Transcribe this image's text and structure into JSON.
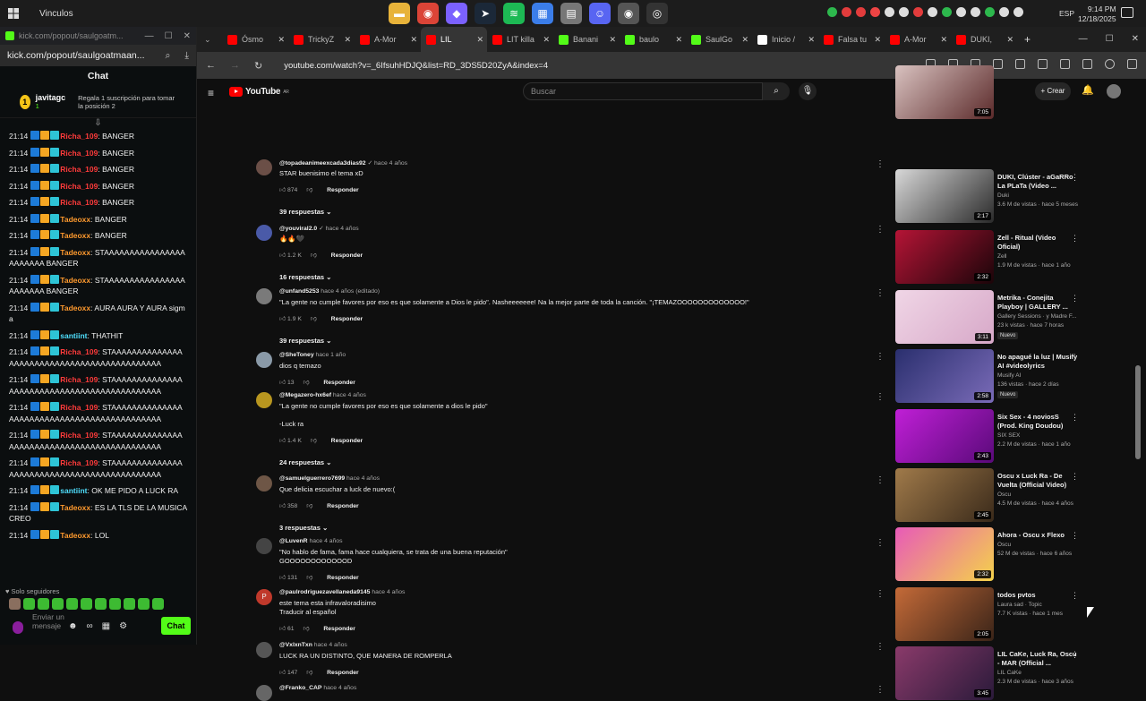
{
  "taskbar": {
    "title": "Vinculos",
    "lang": "ESP",
    "time": "9:14 PM",
    "date": "12/18/2025",
    "apps": [
      {
        "name": "file-explorer-icon",
        "color": "#e8b33a",
        "glyph": "▬"
      },
      {
        "name": "chrome-icon",
        "color": "#db4437",
        "glyph": "◉"
      },
      {
        "name": "copilot-icon",
        "color": "#7b61ff",
        "glyph": "◆"
      },
      {
        "name": "steam-icon",
        "color": "#1b2838",
        "glyph": "➤"
      },
      {
        "name": "spotify-icon",
        "color": "#1db954",
        "glyph": "≋"
      },
      {
        "name": "store-icon",
        "color": "#3b7de9",
        "glyph": "▦"
      },
      {
        "name": "folder-icon",
        "color": "#777",
        "glyph": "▤"
      },
      {
        "name": "discord-icon",
        "color": "#5865f2",
        "glyph": "☺"
      },
      {
        "name": "chrome-active-icon",
        "color": "#555",
        "glyph": "◉"
      },
      {
        "name": "obs-icon",
        "color": "#333",
        "glyph": "◎"
      }
    ],
    "tray_colors": [
      "#2db84d",
      "#e23c3c",
      "#e23c3c",
      "#ee4444",
      "#ddd",
      "#ddd",
      "#e23c3c",
      "#ddd",
      "#2db84d",
      "#ddd",
      "#ddd",
      "#2db84d",
      "#ddd",
      "#ddd"
    ]
  },
  "kick": {
    "window_title": "kick.com/popout/saulgoatm...",
    "url": "kick.com/popout/saulgoatmaan...",
    "header": "Chat",
    "pinned": {
      "badge": "1",
      "user": "javitagc",
      "count": "1",
      "text": "Regala 1 suscripción para tomar la posición 2"
    },
    "messages": [
      {
        "time": "21:14",
        "user": "Richa_109",
        "color": "#ff3b3b",
        "text": "BANGER"
      },
      {
        "time": "21:14",
        "user": "Richa_109",
        "color": "#ff3b3b",
        "text": "BANGER"
      },
      {
        "time": "21:14",
        "user": "Richa_109",
        "color": "#ff3b3b",
        "text": "BANGER"
      },
      {
        "time": "21:14",
        "user": "Richa_109",
        "color": "#ff3b3b",
        "text": "BANGER"
      },
      {
        "time": "21:14",
        "user": "Richa_109",
        "color": "#ff3b3b",
        "text": "BANGER"
      },
      {
        "time": "21:14",
        "user": "Tadeoxx",
        "color": "#ff9a2e",
        "text": "BANGER"
      },
      {
        "time": "21:14",
        "user": "Tadeoxx",
        "color": "#ff9a2e",
        "text": "BANGER"
      },
      {
        "time": "21:14",
        "user": "Tadeoxx",
        "color": "#ff9a2e",
        "text": "STAAAAAAAAAAAAAAAAAAAAAAA BANGER"
      },
      {
        "time": "21:14",
        "user": "Tadeoxx",
        "color": "#ff9a2e",
        "text": "STAAAAAAAAAAAAAAAAAAAAAAA BANGER"
      },
      {
        "time": "21:14",
        "user": "Tadeoxx",
        "color": "#ff9a2e",
        "text": "AURA AURA Y AURA sigma"
      },
      {
        "time": "21:14",
        "user": "santiint",
        "color": "#4fe0ff",
        "text": "THATHIT"
      },
      {
        "time": "21:14",
        "user": "Richa_109",
        "color": "#ff3b3b",
        "text": "STAAAAAAAAAAAAAAAAAAAAAAAAAAAAAAAAAAAAAAAAAAAA"
      },
      {
        "time": "21:14",
        "user": "Richa_109",
        "color": "#ff3b3b",
        "text": "STAAAAAAAAAAAAAAAAAAAAAAAAAAAAAAAAAAAAAAAAAAAA"
      },
      {
        "time": "21:14",
        "user": "Richa_109",
        "color": "#ff3b3b",
        "text": "STAAAAAAAAAAAAAAAAAAAAAAAAAAAAAAAAAAAAAAAAAAAA"
      },
      {
        "time": "21:14",
        "user": "Richa_109",
        "color": "#ff3b3b",
        "text": "STAAAAAAAAAAAAAAAAAAAAAAAAAAAAAAAAAAAAAAAAAAAA"
      },
      {
        "time": "21:14",
        "user": "Richa_109",
        "color": "#ff3b3b",
        "text": "STAAAAAAAAAAAAAAAAAAAAAAAAAAAAAAAAAAAAAAAAAAAA"
      },
      {
        "time": "21:14",
        "user": "santiint",
        "color": "#4fe0ff",
        "text": "OK ME PIDO A LUCK RA"
      },
      {
        "time": "21:14",
        "user": "Tadeoxx",
        "color": "#ff9a2e",
        "text": "ES LA TLS DE LA MUSICA CREO"
      },
      {
        "time": "21:14",
        "user": "Tadeoxx",
        "color": "#ff9a2e",
        "text": "LOL"
      }
    ],
    "solo": "Solo seguidores",
    "input_placeholder": "Enviar un mensaje",
    "chat_button": "Chat"
  },
  "chrome": {
    "tabs": [
      {
        "label": "Ósmo",
        "color": "#ff0000"
      },
      {
        "label": "TrickyZ",
        "color": "#ff0000"
      },
      {
        "label": "A-Mor",
        "color": "#ff0000"
      },
      {
        "label": "LIL",
        "color": "#ff0000",
        "active": true
      },
      {
        "label": "LIT killa",
        "color": "#ff0000"
      },
      {
        "label": "Banani",
        "color": "#53fc18"
      },
      {
        "label": "baulo",
        "color": "#53fc18"
      },
      {
        "label": "SaulGo",
        "color": "#53fc18"
      },
      {
        "label": "Inicio /",
        "color": "#fff"
      },
      {
        "label": "Falsa tu",
        "color": "#ff0000"
      },
      {
        "label": "A-Mor",
        "color": "#ff0000"
      },
      {
        "label": "DUKI,",
        "color": "#ff0000"
      }
    ],
    "url": "youtube.com/watch?v=_6IfsuhHDJQ&list=RD_3DS5D20ZyA&index=4"
  },
  "youtube": {
    "logo": "YouTube",
    "logo_sup": "AR",
    "search_placeholder": "Buscar",
    "create": "Crear",
    "comments": [
      {
        "user": "@topadeanimeexcada3dias92",
        "age": "✓ hace 4 años",
        "text": "STAR buenisimo el tema xD",
        "likes": "874",
        "replies": "39 respuestas",
        "avatar": "#6b4f47"
      },
      {
        "user": "@youviral2.0",
        "age": "✓ hace 4 años",
        "text": "🔥🔥🖤",
        "likes": "1.2 K",
        "replies": "16 respuestas",
        "avatar": "#4a5aa8"
      },
      {
        "user": "@unfand5253",
        "age": "hace 4 años (editado)",
        "text": "\"La gente no cumple favores por eso es que solamente a Dios le pido\". Nasheeeeeee! Na la mejor parte de toda la canción. \"¡TEMAZOOOOOOOOOOOOO!\"",
        "likes": "1.9 K",
        "replies": "39 respuestas",
        "avatar": "#7a7a7a"
      },
      {
        "user": "@SheToney",
        "age": "hace 1 año",
        "text": "dios q temazo",
        "likes": "13",
        "replies": "",
        "avatar": "#8a9aa8"
      },
      {
        "user": "@Megazero-hx6ef",
        "age": "hace 4 años",
        "text": "\"La gente no cumple favores por eso es que solamente a dios le pido\"\n\n-Luck ra",
        "likes": "1.4 K",
        "replies": "24 respuestas",
        "avatar": "#b8961f"
      },
      {
        "user": "@samuelguerrero7699",
        "age": "hace 4 años",
        "text": "Que delicia escuchar a luck de nuevo:(",
        "likes": "358",
        "replies": "3 respuestas",
        "avatar": "#6e5646"
      },
      {
        "user": "@LuvenR",
        "age": "hace 4 años",
        "text": "\"No hablo de fama, fama hace cualquiera, se trata de una buena reputación\"\nGOOOOOOOOOOOOD",
        "likes": "131",
        "replies": "",
        "avatar": "#444"
      },
      {
        "user": "@paulrodriguezavellaneda9145",
        "age": "hace 4 años",
        "text": "este tema esta infravaloradisimo\nTraducir al español",
        "likes": "61",
        "replies": "",
        "avatar": "#c0392b",
        "initial": "P"
      },
      {
        "user": "@VxlxnTxn",
        "age": "hace 4 años",
        "text": "LUCK RA UN DISTINTO, QUE MANERA DE ROMPERLA",
        "likes": "147",
        "replies": "",
        "avatar": "#555"
      },
      {
        "user": "@Franko_CAP",
        "age": "hace 4 años",
        "text": "",
        "likes": "",
        "replies": "",
        "avatar": "#666"
      }
    ],
    "reply_label": "Responder",
    "sidebar": [
      {
        "title": "",
        "channel": "",
        "stats": "",
        "duration": "7:05",
        "colors": [
          "#d9c2c0",
          "#5b2a2a"
        ]
      },
      {
        "title": "DUKI, Clúster - aGaRRo La PLaTa (Video ...",
        "channel": "Duki",
        "stats": "3.6 M de vistas · hace 5 meses",
        "duration": "2:17",
        "colors": [
          "#d8d8d8",
          "#2a2a2a"
        ]
      },
      {
        "title": "Zell - Ritual (Video Oficial)",
        "channel": "Zell",
        "stats": "1.9 M de vistas · hace 1 año",
        "duration": "2:32",
        "colors": [
          "#b51436",
          "#1a0509"
        ]
      },
      {
        "title": "Metrika - Conejita Playboy | GALLERY ...",
        "channel": "Gallery Sessions · y Madre F...",
        "stats": "23 k vistas · hace 7 horas",
        "duration": "3:11",
        "colors": [
          "#f0d6e6",
          "#d7a8c8"
        ],
        "nuevo": "Nuevo"
      },
      {
        "title": "No apagué la luz | Musify AI #videolyrics",
        "channel": "Musify AI",
        "stats": "136 vistas · hace 2 días",
        "duration": "2:58",
        "colors": [
          "#2a2f6e",
          "#7a6bb8"
        ],
        "nuevo": "Nuevo"
      },
      {
        "title": "Six Sex - 4 noviosS (Prod. King Doudou)",
        "channel": "SIX SEX",
        "stats": "2.2 M de vistas · hace 1 año",
        "duration": "2:43",
        "colors": [
          "#c01fd6",
          "#5a0a7a"
        ]
      },
      {
        "title": "Oscu x Luck Ra - De Vuelta (Official Video)",
        "channel": "Oscu",
        "stats": "4.5 M de vistas · hace 4 años",
        "duration": "2:45",
        "colors": [
          "#a07a4a",
          "#3a2a1a"
        ]
      },
      {
        "title": "Ahora - Oscu x Flexo",
        "channel": "Oscu",
        "stats": "52 M de vistas · hace 6 años",
        "duration": "2:32",
        "colors": [
          "#e85ab8",
          "#f4d24a"
        ]
      },
      {
        "title": "todos pvtos",
        "channel": "Laura sad · Topic",
        "stats": "7.7 K vistas · hace 1 mes",
        "duration": "2:05",
        "colors": [
          "#c46a38",
          "#3a2418"
        ]
      },
      {
        "title": "LIL CaKe, Luck Ra, Oscu - MAR (Official ...",
        "channel": "LIL CaKe",
        "stats": "2.3 M de vistas · hace 3 años",
        "duration": "3:45",
        "colors": [
          "#8a3a6a",
          "#2a1a3a"
        ]
      }
    ]
  }
}
